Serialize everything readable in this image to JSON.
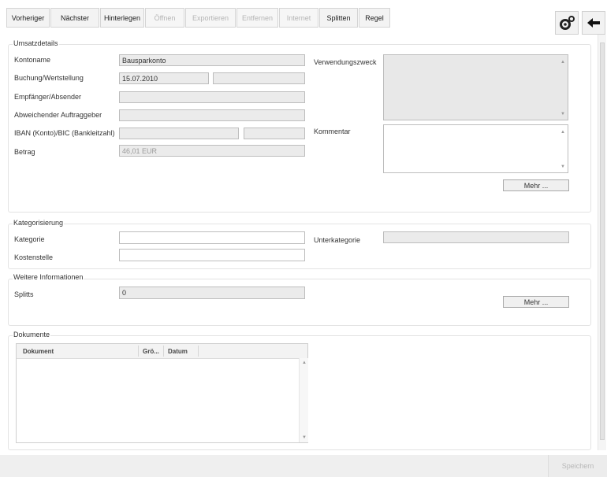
{
  "toolbar": {
    "buttons": [
      {
        "label": "Vorheriger",
        "enabled": true
      },
      {
        "label": "Nächster",
        "enabled": true
      },
      {
        "label": "Hinterlegen",
        "enabled": true
      },
      {
        "label": "Öffnen",
        "enabled": false
      },
      {
        "label": "Exportieren",
        "enabled": false
      },
      {
        "label": "Entfernen",
        "enabled": false
      },
      {
        "label": "Internet",
        "enabled": false
      },
      {
        "label": "Splitten",
        "enabled": true
      },
      {
        "label": "Regel",
        "enabled": true
      }
    ],
    "icons": [
      "gears-icon",
      "back-arrow-icon"
    ]
  },
  "umsatzdetails": {
    "title": "Umsatzdetails",
    "kontoname_label": "Kontoname",
    "kontoname_value": "Bausparkonto",
    "buchung_label": "Buchung/Wertstellung",
    "buchung_value": "15.07.2010",
    "wertstellung_value": "",
    "empfaenger_label": "Empfänger/Absender",
    "empfaenger_value": "",
    "auftraggeber_label": "Abweichender Auftraggeber",
    "auftraggeber_value": "",
    "iban_label": "IBAN (Konto)/BIC (Bankleitzahl)",
    "iban_value": "",
    "bic_value": "",
    "betrag_label": "Betrag",
    "betrag_value": "46,01 EUR",
    "verwendungszweck_label": "Verwendungszweck",
    "kommentar_label": "Kommentar",
    "mehr_label": "Mehr ..."
  },
  "kategorisierung": {
    "title": "Kategorisierung",
    "kategorie_label": "Kategorie",
    "kategorie_value": "",
    "unterkategorie_label": "Unterkategorie",
    "unterkategorie_value": "",
    "kostenstelle_label": "Kostenstelle",
    "kostenstelle_value": ""
  },
  "weitere": {
    "title": "Weitere Informationen",
    "splitts_label": "Splitts",
    "splitts_value": "0",
    "mehr_label": "Mehr ..."
  },
  "dokumente": {
    "title": "Dokumente",
    "columns": [
      "Dokument",
      "Grö...",
      "Datum"
    ]
  },
  "footer": {
    "save_label": "Speichern"
  }
}
